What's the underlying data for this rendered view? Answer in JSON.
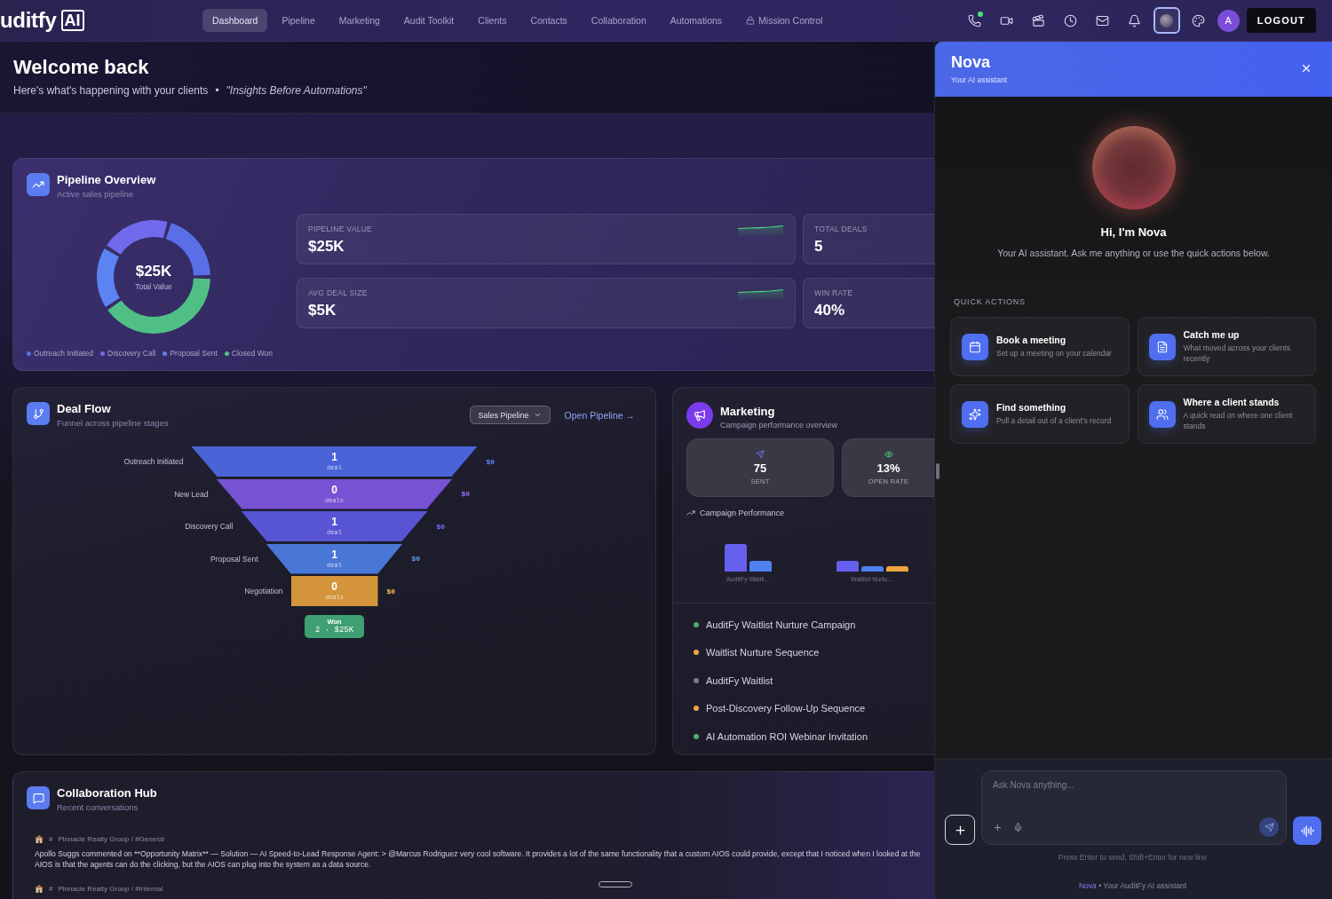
{
  "nav": {
    "logo": {
      "text": "uditfy",
      "badge": "AI"
    },
    "items": [
      {
        "label": "Dashboard",
        "selected": true,
        "locked": false
      },
      {
        "label": "Pipeline",
        "selected": false,
        "locked": false
      },
      {
        "label": "Marketing",
        "selected": false,
        "locked": false
      },
      {
        "label": "Audit Toolkit",
        "selected": false,
        "locked": false
      },
      {
        "label": "Clients",
        "selected": false,
        "locked": false
      },
      {
        "label": "Contacts",
        "selected": false,
        "locked": false
      },
      {
        "label": "Collaboration",
        "selected": false,
        "locked": false
      },
      {
        "label": "Automations",
        "selected": false,
        "locked": false
      },
      {
        "label": "Mission Control",
        "selected": false,
        "locked": true
      }
    ],
    "toolbar": [
      {
        "kind": "phone",
        "badge": true,
        "active": false
      },
      {
        "kind": "video",
        "badge": false,
        "active": false
      },
      {
        "kind": "clapper",
        "badge": false,
        "active": false
      },
      {
        "kind": "clock",
        "badge": false,
        "active": false
      },
      {
        "kind": "mail",
        "badge": false,
        "active": false
      },
      {
        "kind": "bell",
        "badge": false,
        "active": false
      },
      {
        "kind": "orb",
        "badge": false,
        "active": true
      },
      {
        "kind": "palette",
        "badge": false,
        "active": false
      }
    ],
    "avatar": "A",
    "logout": "LOGOUT"
  },
  "welcome": {
    "title": "Welcome back",
    "subtitle": "Here's what's happening with your clients",
    "separator": "•",
    "tagline": "\"Insights Before Automations\""
  },
  "pipeline_overview": {
    "title": "Pipeline Overview",
    "subtitle": "Active sales pipeline",
    "total": {
      "value": "$25K",
      "caption": "Total Value"
    },
    "legend": [
      {
        "label": "Outreach Initiated",
        "color": "#5a6fe6"
      },
      {
        "label": "Discovery Call",
        "color": "#716aec"
      },
      {
        "label": "Proposal Sent",
        "color": "#5b84f2"
      },
      {
        "label": "Closed Won",
        "color": "#4fbf86"
      }
    ],
    "stats": [
      {
        "kind": "trend",
        "label": "PIPELINE VALUE",
        "value": "$25K"
      },
      {
        "kind": "plain",
        "label": "TOTAL DEALS",
        "value": "5"
      },
      {
        "kind": "trend",
        "label": "AVG DEAL SIZE",
        "value": "$5K"
      },
      {
        "kind": "plain",
        "label": "WIN RATE",
        "value": "40%"
      }
    ]
  },
  "deal_flow": {
    "title": "Deal Flow",
    "subtitle": "Funnel across pipeline stages",
    "select": "Sales Pipeline",
    "link": "Open Pipeline →",
    "stages": [
      {
        "label": "Outreach Initiated",
        "count": "1",
        "unit": "deal",
        "amount": "$0",
        "color": "#4a64d8"
      },
      {
        "label": "New Lead",
        "count": "0",
        "unit": "deals",
        "amount": "$0",
        "color": "#7752d2"
      },
      {
        "label": "Discovery Call",
        "count": "1",
        "unit": "deal",
        "amount": "$0",
        "color": "#5755d4"
      },
      {
        "label": "Proposal Sent",
        "count": "1",
        "unit": "deal",
        "amount": "$0",
        "color": "#4877d6"
      },
      {
        "label": "Negotiation",
        "count": "0",
        "unit": "deals",
        "amount": "$0",
        "color": "#d3943b"
      }
    ],
    "won": {
      "label": "Won",
      "summary": "2 · $25K"
    }
  },
  "marketing": {
    "title": "Marketing",
    "subtitle": "Campaign performance overview",
    "stats": [
      {
        "kind": "sent",
        "value": "75",
        "label": "SENT"
      },
      {
        "kind": "opened",
        "value": "13%",
        "label": "OPEN RATE"
      }
    ],
    "chart": {
      "title": "Campaign Performance",
      "groups": [
        {
          "label": "AuditFy Waitli…",
          "bars": [
            {
              "color": "#6560ee"
            },
            {
              "color": "#4f82f0"
            }
          ]
        },
        {
          "label": "Waitlist Nurtu…",
          "bars": [
            {
              "color": "#6560ee"
            },
            {
              "color": "#4f82f0"
            },
            {
              "color": "#f0a53e"
            }
          ]
        }
      ]
    },
    "campaigns": [
      {
        "name": "AuditFy Waitlist Nurture Campaign",
        "color": "#4caf6e"
      },
      {
        "name": "Waitlist Nurture Sequence",
        "color": "#f0a640"
      },
      {
        "name": "AuditFy Waitlist",
        "color": "#7a7a84"
      },
      {
        "name": "Post-Discovery Follow-Up Sequence",
        "color": "#f0a641"
      },
      {
        "name": "AI Automation ROI Webinar Invitation",
        "color": "#4caf6f"
      }
    ]
  },
  "collaboration": {
    "title": "Collaboration Hub",
    "subtitle": "Recent conversations",
    "messages": [
      {
        "prefix": "#",
        "channel": "Pinnacle Realty Group / #General",
        "text": "Apollo Suggs commented on **Opportunity Matrix** — Solution — AI Speed-to-Lead Response Agent: > @Marcus Rodriguez very cool software. It provides a lot of the same functionality that a custom AIOS could provide, except that I noticed when I looked at the AIOS is that the agents can do the clicking, but the AIOS can plug into the system as a data source."
      },
      {
        "prefix": "#",
        "channel": "Pinnacle Realty Group / #Internal"
      }
    ]
  },
  "assistant": {
    "name": "Nova",
    "tagline": "Your AI assistant",
    "greeting": "Hi, I'm Nova",
    "intro": "Your AI assistant. Ask me anything or use the quick actions below.",
    "quick_actions_title": "QUICK ACTIONS",
    "quick_actions": [
      {
        "kind": "calendar",
        "title": "Book a meeting",
        "description": "Set up a meeting on your calendar"
      },
      {
        "kind": "document",
        "title": "Catch me up",
        "description": "What moved across your clients recently"
      },
      {
        "kind": "sparkle",
        "title": "Find something",
        "description": "Pull a detail out of a client's record"
      },
      {
        "kind": "people",
        "title": "Where a client stands",
        "description": "A quick read on where one client stands"
      }
    ],
    "input": {
      "placeholder": "Ask Nova anything..."
    },
    "hint": "Press Enter to send, Shift+Enter for new line",
    "footer": {
      "name": "Nova",
      "separator": "•",
      "text": "Your AuditFy AI assistant"
    }
  }
}
